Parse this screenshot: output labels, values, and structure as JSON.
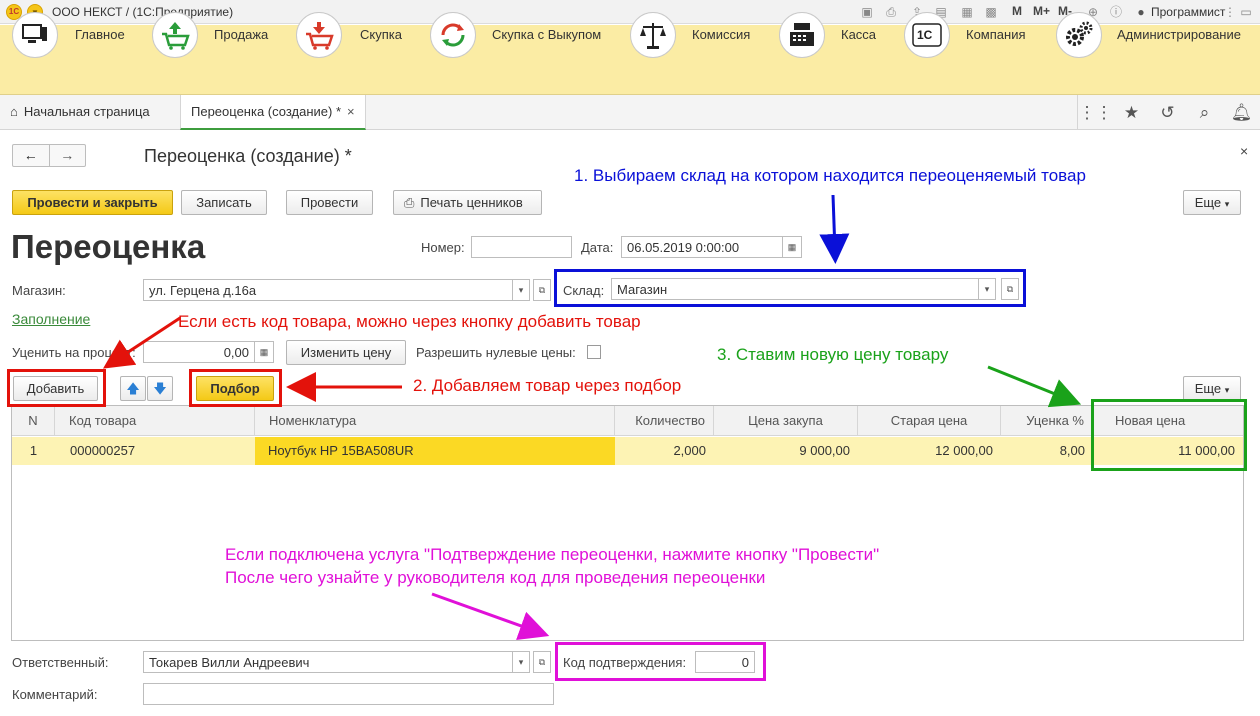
{
  "app": {
    "title": "ООО НЕКСТ / (1С:Предприятие)",
    "user": "Программист",
    "toolbar_m": [
      "M",
      "M+",
      "M-"
    ]
  },
  "sections": [
    {
      "label": "Главное",
      "icon": "computer-icon"
    },
    {
      "label": "Продажа",
      "icon": "cart-up-icon"
    },
    {
      "label": "Скупка",
      "icon": "cart-down-icon"
    },
    {
      "label": "Скупка с Выкупом",
      "icon": "cycle-arrows-icon"
    },
    {
      "label": "Комиссия",
      "icon": "scales-icon"
    },
    {
      "label": "Касса",
      "icon": "cash-register-icon"
    },
    {
      "label": "Компания",
      "icon": "1c-company-icon"
    },
    {
      "label": "Администрирование",
      "icon": "gears-icon"
    }
  ],
  "tabs": [
    {
      "label": "Начальная страница"
    },
    {
      "label": "Переоценка (создание) *",
      "close": "×"
    }
  ],
  "form": {
    "window_title": "Переоценка (создание) *",
    "close": "×",
    "buttons": {
      "post_close": "Провести и закрыть",
      "save": "Записать",
      "post": "Провести",
      "print_tags": "Печать ценников",
      "more": "Еще"
    },
    "heading": "Переоценка",
    "number_label": "Номер:",
    "number_value": "",
    "date_label": "Дата:",
    "date_value": "06.05.2019  0:00:00",
    "store_label": "Магазин:",
    "store_value": "ул. Герцена д.16а",
    "warehouse_label": "Склад:",
    "warehouse_value": "Магазин",
    "fill_link": "Заполнение",
    "discount_label": "Уценить на процент:",
    "discount_value": "0,00",
    "change_price": "Изменить цену",
    "allow_zero": "Разрешить нулевые цены:",
    "add": "Добавить",
    "pick": "Подбор",
    "more2": "Еще",
    "responsible_label": "Ответственный:",
    "responsible_value": "Токарев Вилли Андреевич",
    "confirm_label": "Код подтверждения:",
    "confirm_value": "0",
    "comment_label": "Комментарий:",
    "comment_value": ""
  },
  "table": {
    "columns": [
      "N",
      "Код товара",
      "Номенклатура",
      "Количество",
      "Цена закупа",
      "Старая цена",
      "Уценка %",
      "Новая цена"
    ],
    "rows": [
      {
        "n": "1",
        "code": "000000257",
        "name": "Ноутбук HP 15BA508UR",
        "qty": "2,000",
        "buy": "9 000,00",
        "old": "12 000,00",
        "disc": "8,00",
        "new": "11 000,00"
      }
    ]
  },
  "annotations": {
    "step1": "1. Выбираем склад на котором находится переоценяемый товар",
    "step2": "2. Добавляем товар через подбор",
    "step3": "3. Ставим новую цену товару",
    "code_hint": "Если есть код товара, можно через кнопку добавить товар",
    "confirm_hint_1": "Если подключена услуга \"Подтверждение переоценки, нажмите кнопку \"Провести\"",
    "confirm_hint_2": "После чего узнайте у руководителя код для проведения переоценки"
  },
  "colors": {
    "step1": "#0a10d8",
    "step2": "#e3120b",
    "step3": "#1aa21a",
    "confirm": "#e010d8",
    "sections_bg": "#fbeca4"
  }
}
